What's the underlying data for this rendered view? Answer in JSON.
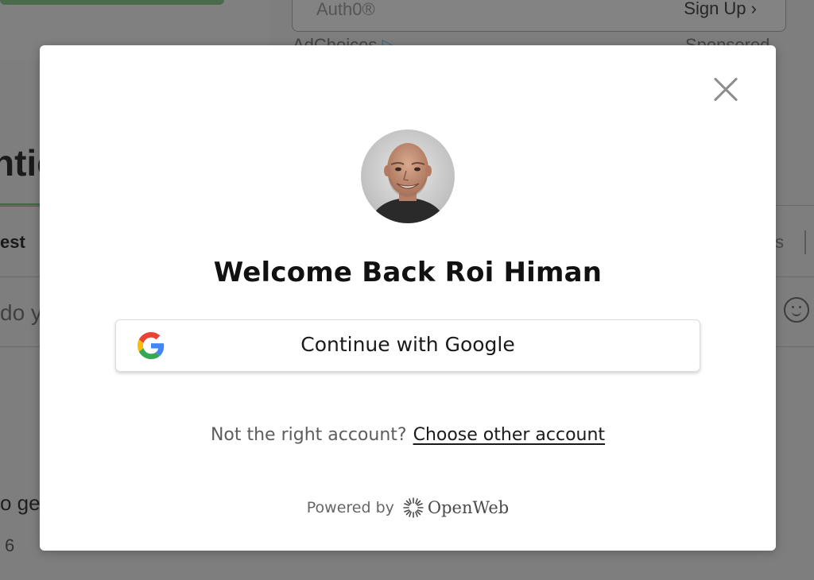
{
  "background": {
    "auth_provider": "Auth0®",
    "sign_up_label": "Sign Up",
    "ad_choices": "AdChoices",
    "sponsored": "Sponsored",
    "section_heading_fragment": "ntic",
    "tab_fragment": "est",
    "tab_right_fragment": "s",
    "input_fragment": "do y",
    "comment_fragment": "o ge",
    "count_fragment": "6"
  },
  "modal": {
    "title": "Welcome Back Roi Himan",
    "google_button_label": "Continue with Google",
    "not_right_account": "Not the right account?",
    "choose_other_account": "Choose other account",
    "powered_by": "Powered by",
    "brand_name": "OpenWeb",
    "icons": {
      "close": "close-icon",
      "google": "google-icon",
      "brand": "openweb-logo"
    }
  },
  "colors": {
    "overlay": "#7e7e7e",
    "modal_bg": "#ffffff",
    "text_primary": "#111111",
    "text_muted": "#5d5d5d",
    "google_blue": "#4285F4",
    "google_red": "#EA4335",
    "google_yellow": "#FBBC05",
    "google_green": "#34A853"
  }
}
